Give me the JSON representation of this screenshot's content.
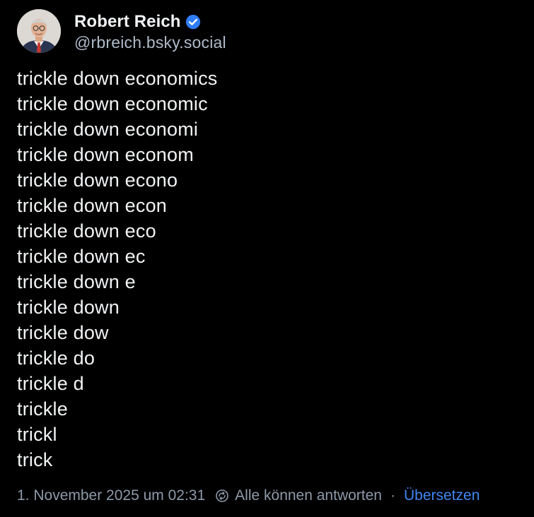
{
  "post": {
    "author": {
      "display_name": "Robert Reich",
      "handle": "@rbreich.bsky.social",
      "verified": true,
      "avatar_icon": "avatar-photo"
    },
    "text_lines": [
      "trickle down economics",
      "trickle down economic",
      "trickle down economi",
      "trickle down econom",
      "trickle down econo",
      "trickle down econ",
      "trickle down eco",
      "trickle down ec",
      "trickle down e",
      "trickle down",
      "trickle dow",
      "trickle do",
      "trickle d",
      "trickle",
      "trickl",
      "trick"
    ],
    "meta": {
      "timestamp": "1. November 2025 um 02:31",
      "reply_icon": "reply-settings-icon",
      "reply_setting": "Alle können antworten",
      "separator": "·",
      "translate_label": "Übersetzen"
    }
  },
  "colors": {
    "background": "#000000",
    "text": "#f1f3f5",
    "muted": "#8d9aa9",
    "handle": "#aebbc9",
    "accent": "#3f86f2",
    "verified": "#2f7df6"
  }
}
